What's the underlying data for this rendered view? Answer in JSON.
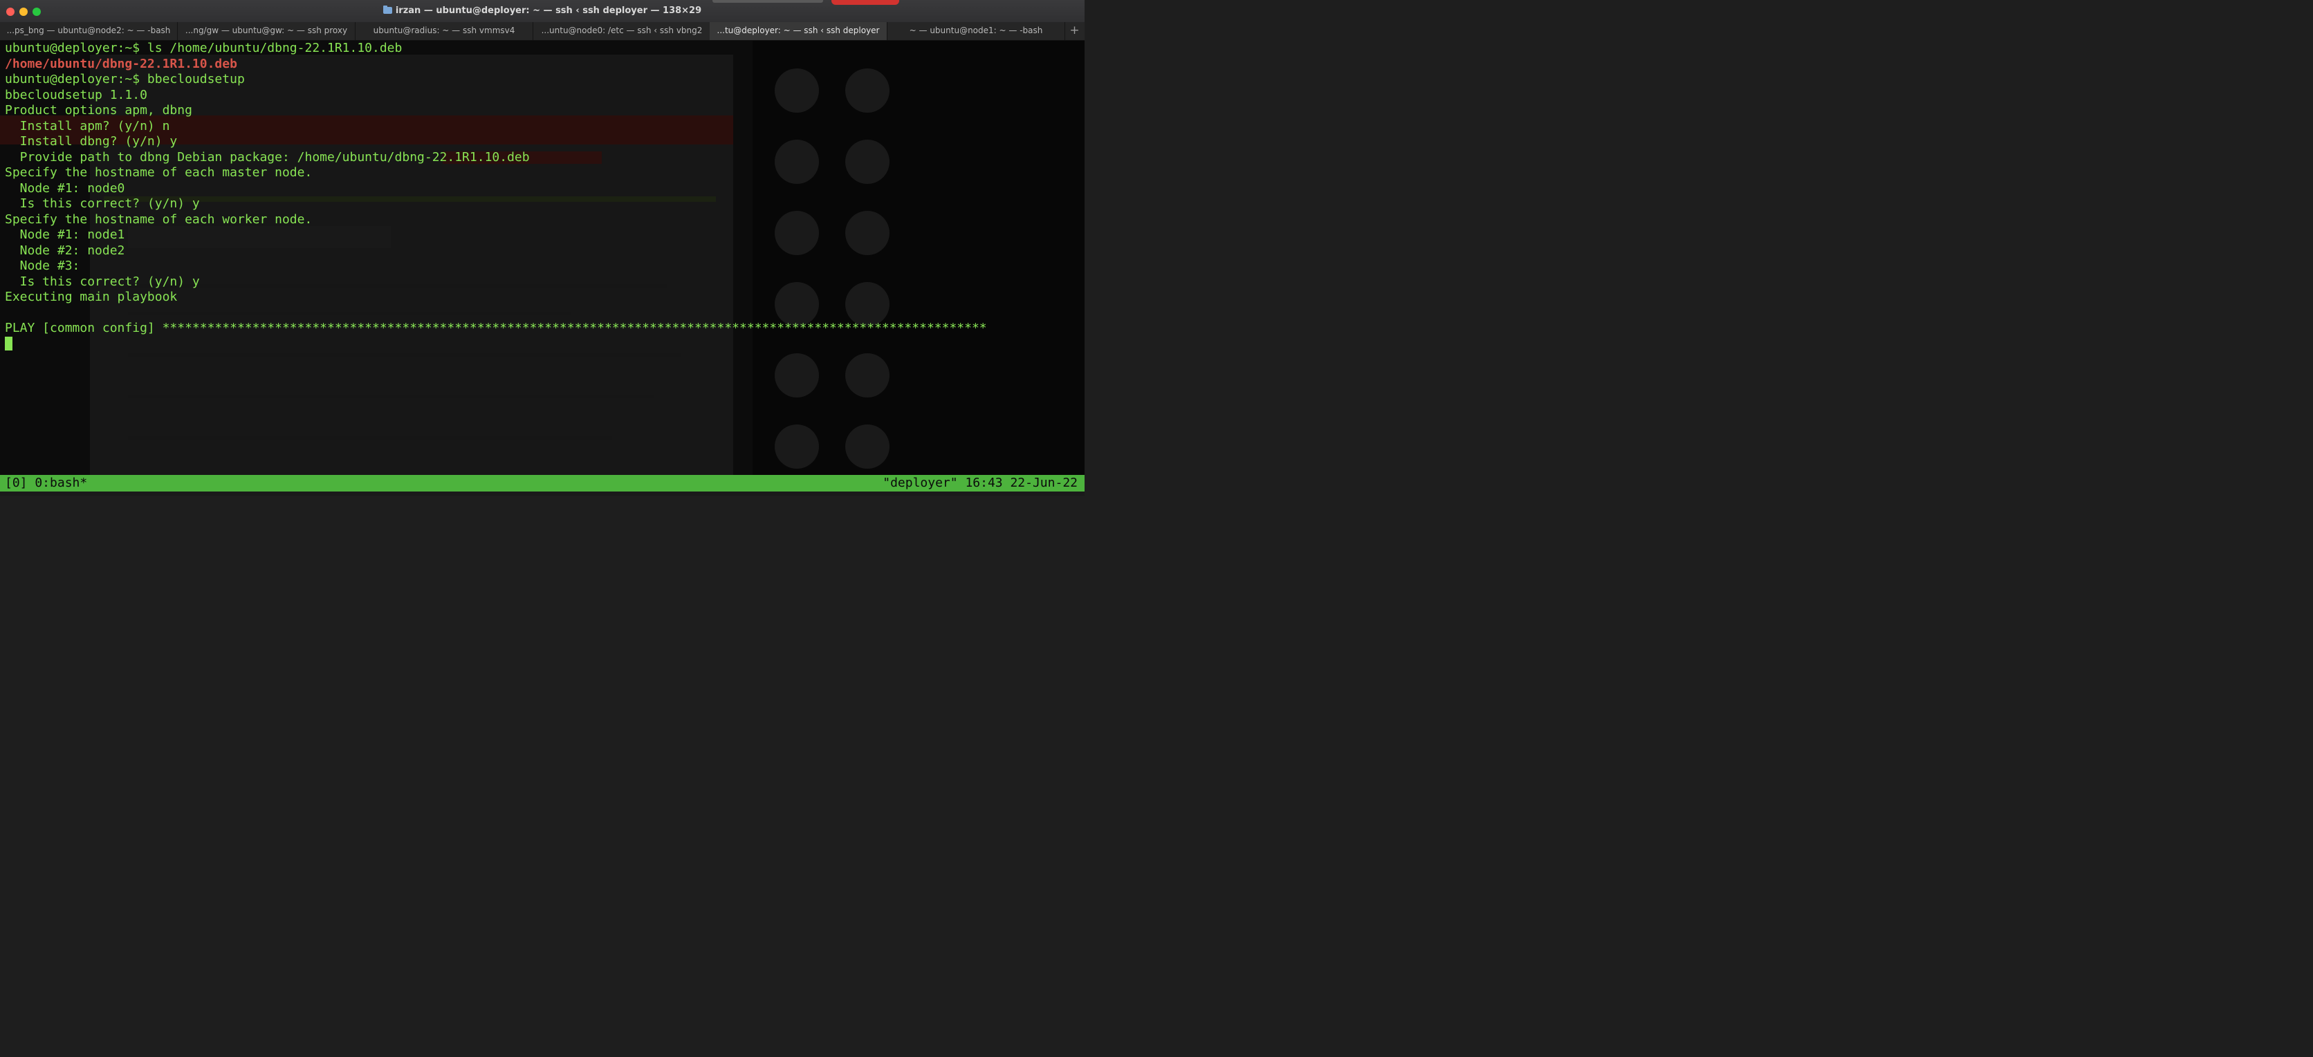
{
  "window": {
    "title": "irzan — ubuntu@deployer: ~ — ssh ‹ ssh deployer — 138×29"
  },
  "tabs": [
    {
      "label": "...ps_bng — ubuntu@node2: ~ — -bash",
      "active": false
    },
    {
      "label": "...ng/gw — ubuntu@gw: ~ — ssh proxy",
      "active": false
    },
    {
      "label": "ubuntu@radius: ~ — ssh vmmsv4",
      "active": false
    },
    {
      "label": "...untu@node0: /etc — ssh ‹ ssh vbng2",
      "active": false
    },
    {
      "label": "...tu@deployer: ~ — ssh ‹ ssh deployer",
      "active": true
    },
    {
      "label": "~ — ubuntu@node1: ~ — -bash",
      "active": false
    }
  ],
  "new_tab_label": "+",
  "terminal": {
    "lines": [
      "ubuntu@deployer:~$ ls /home/ubuntu/dbng-22.1R1.10.deb",
      "/home/ubuntu/dbng-22.1R1.10.deb",
      "ubuntu@deployer:~$ bbecloudsetup",
      "bbecloudsetup 1.1.0",
      "Product options apm, dbng",
      "  Install apm? (y/n) n",
      "  Install dbng? (y/n) y",
      "  Provide path to dbng Debian package: /home/ubuntu/dbng-22.1R1.10.deb",
      "Specify the hostname of each master node.",
      "  Node #1: node0",
      "  Is this correct? (y/n) y",
      "Specify the hostname of each worker node.",
      "  Node #1: node1",
      "  Node #2: node2",
      "  Node #3:",
      "  Is this correct? (y/n) y",
      "Executing main playbook",
      "",
      "PLAY [common config] **************************************************************************************************************"
    ]
  },
  "statusbar": {
    "left": "[0] 0:bash*",
    "right": "\"deployer\" 16:43 22-Jun-22"
  },
  "colors": {
    "terminal_text": "#88e454",
    "error_path": "#d8554a",
    "status_bar": "#4db33d"
  }
}
